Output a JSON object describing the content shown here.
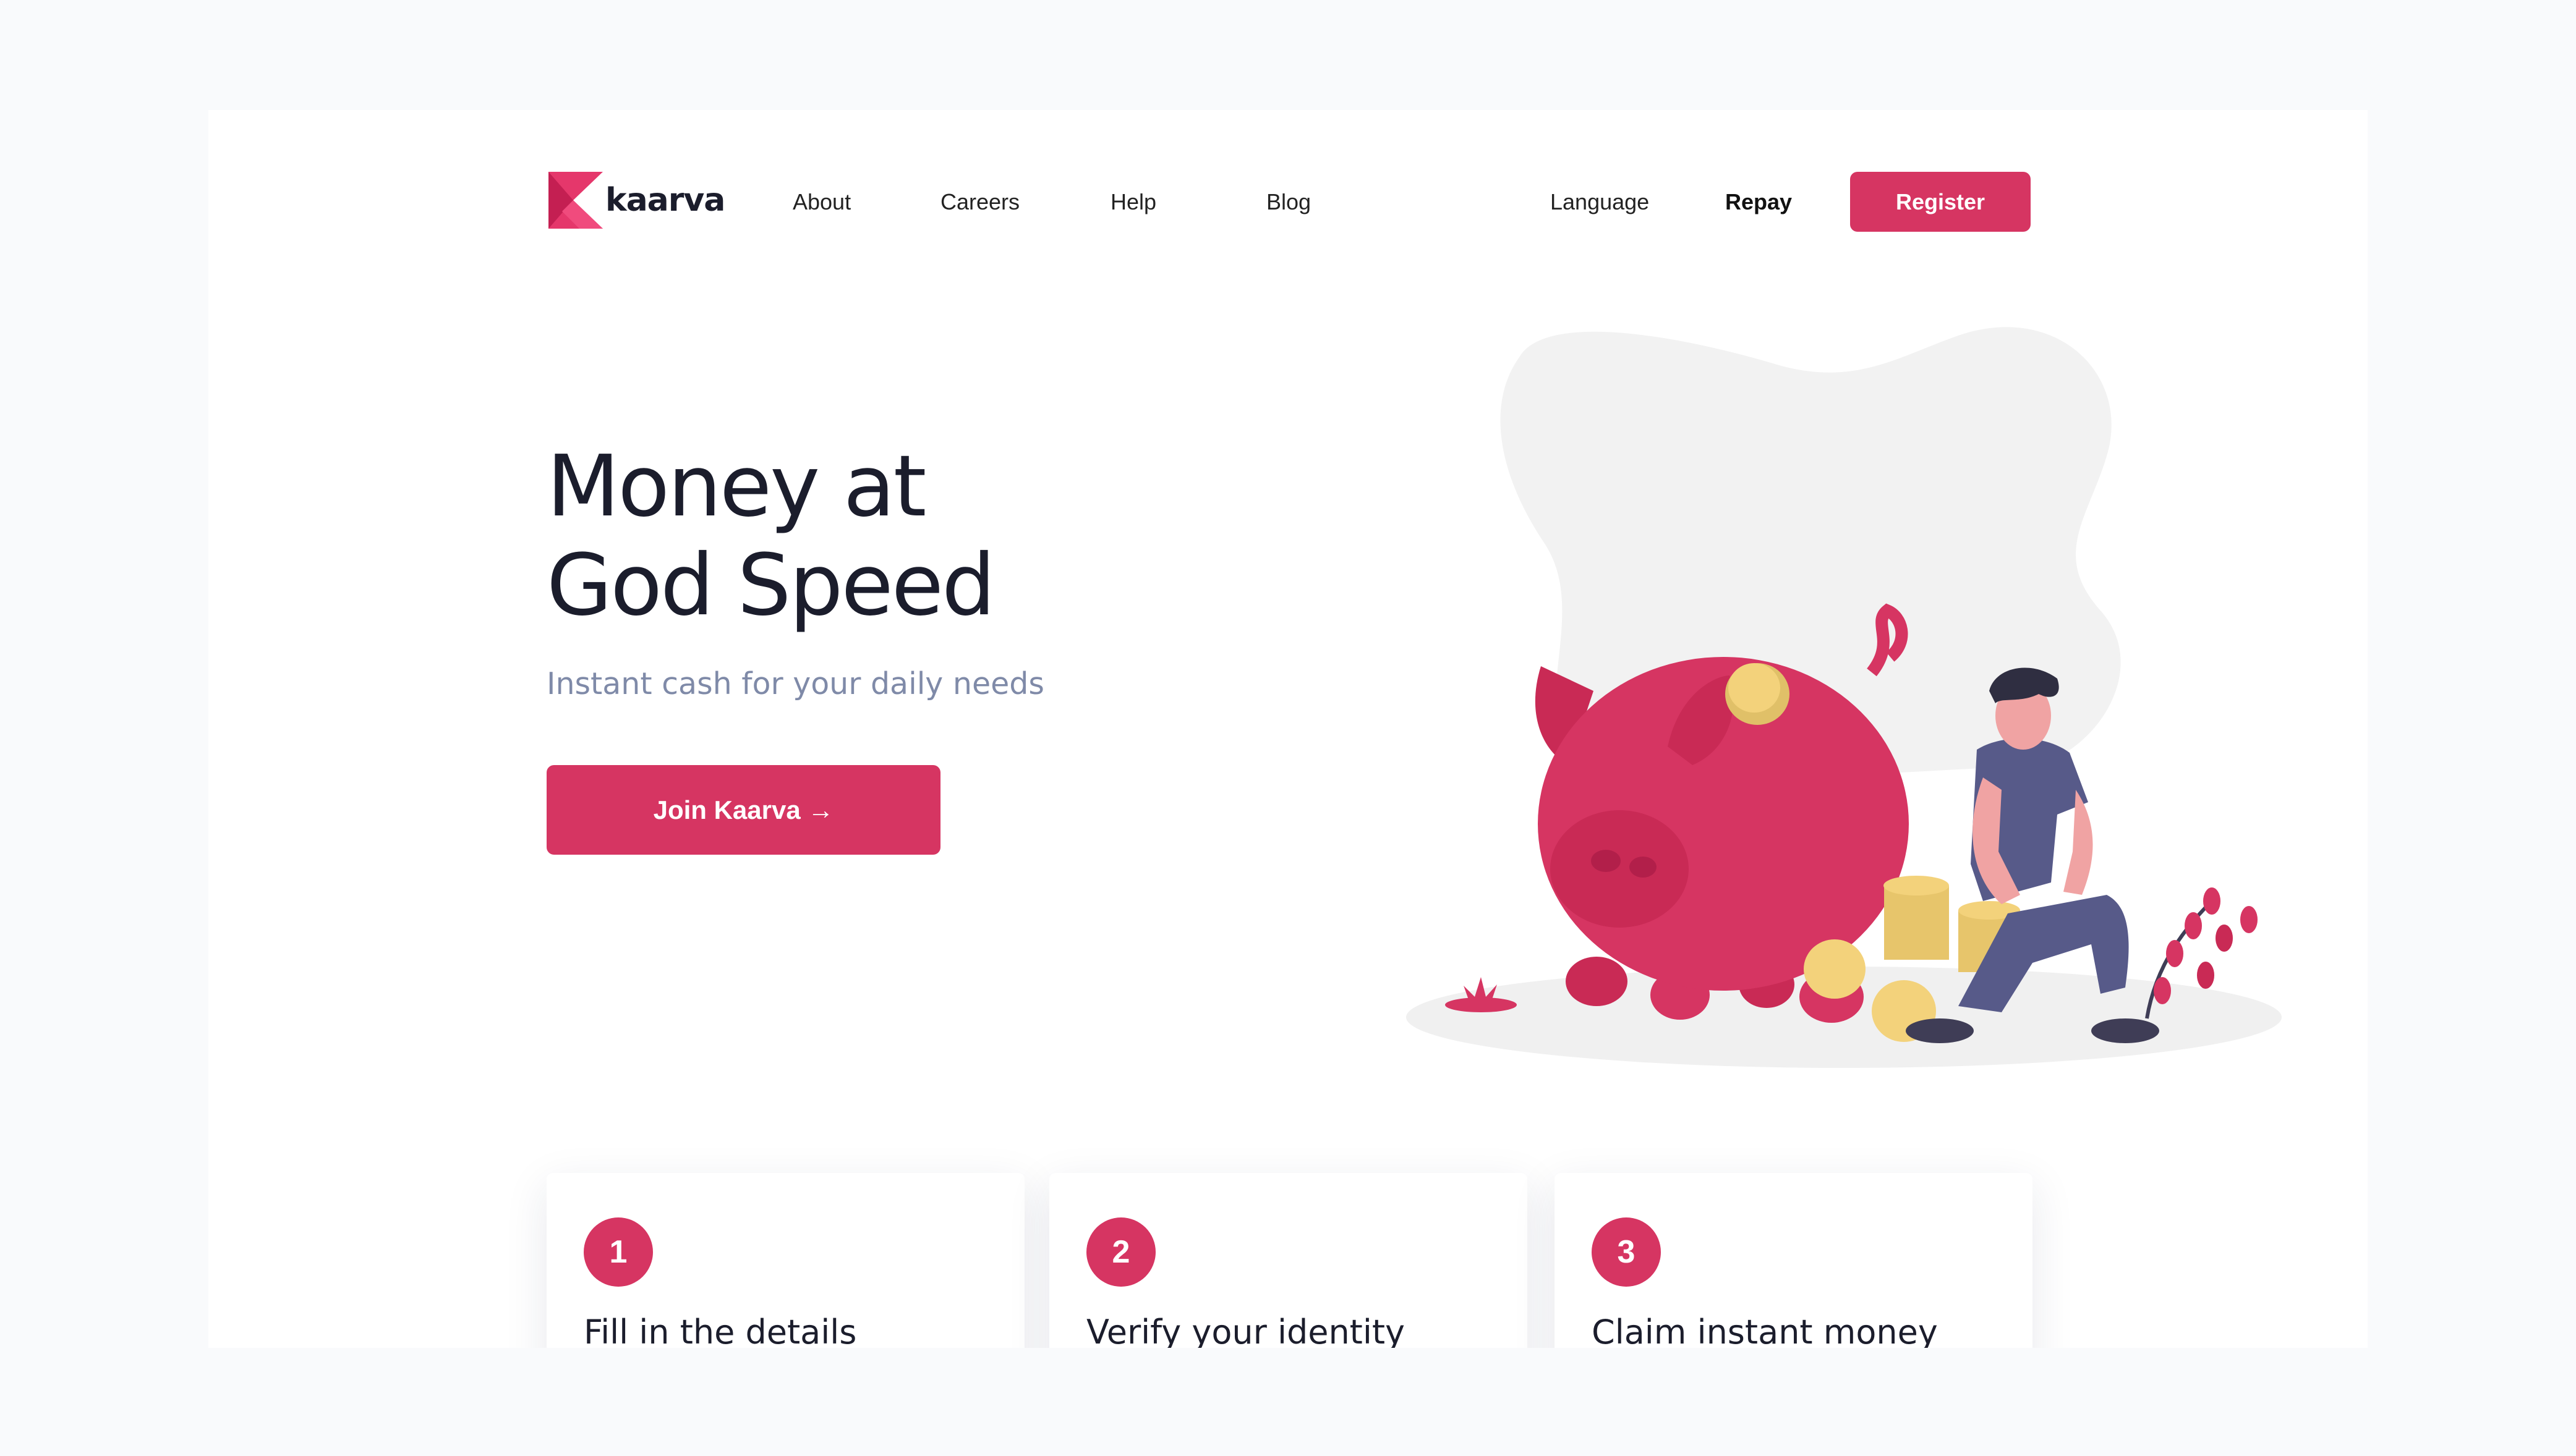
{
  "brand": {
    "name": "kaarva",
    "accent": "#d63562",
    "logo_icon": "kaarva-logo-icon"
  },
  "nav": {
    "about": "About",
    "careers": "Careers",
    "help": "Help",
    "blog": "Blog",
    "language": "Language",
    "repay": "Repay",
    "register": "Register"
  },
  "hero": {
    "title_line1": "Money at",
    "title_line2": "God Speed",
    "subtitle": "Instant cash for your daily needs",
    "cta": "Join Kaarva →",
    "illustration": "piggy-bank-man-coins-illustration"
  },
  "steps": [
    {
      "number": "1",
      "title": "Fill in the details"
    },
    {
      "number": "2",
      "title": "Verify your identity"
    },
    {
      "number": "3",
      "title": "Claim instant money"
    }
  ]
}
